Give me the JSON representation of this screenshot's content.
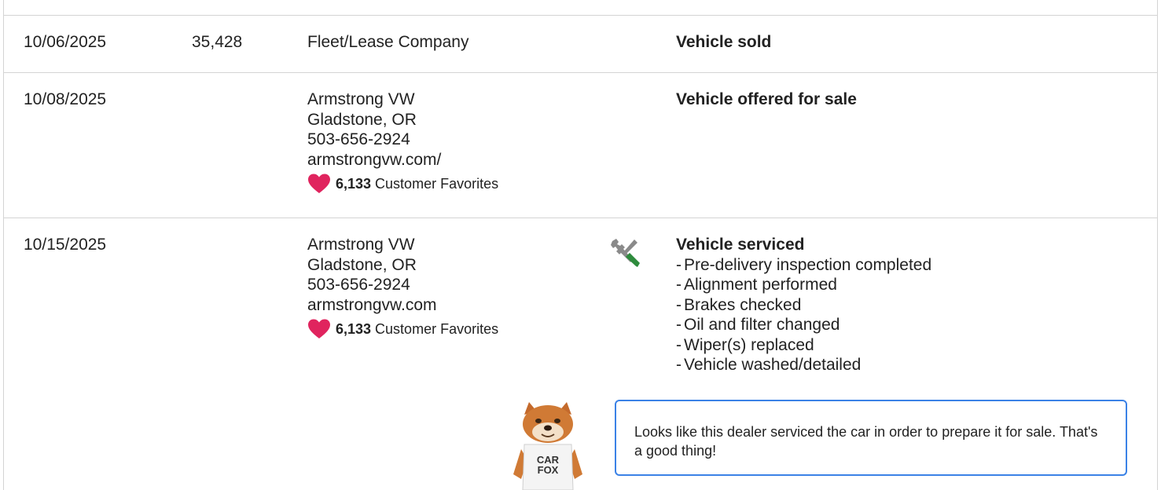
{
  "records": [
    {
      "date": "10/06/2025",
      "odometer": "35,428",
      "source_lines": [
        "Fleet/Lease Company"
      ],
      "title": "Vehicle sold"
    },
    {
      "date": "10/08/2025",
      "odometer": "",
      "source_lines": [
        "Armstrong VW",
        "Gladstone, OR",
        "503-656-2924",
        "armstrongvw.com/"
      ],
      "favorites_count": "6,133",
      "favorites_label": "Customer Favorites",
      "title": "Vehicle offered for sale"
    },
    {
      "date": "10/15/2025",
      "odometer": "",
      "source_lines": [
        "Armstrong VW",
        "Gladstone, OR",
        "503-656-2924",
        "armstrongvw.com"
      ],
      "favorites_count": "6,133",
      "favorites_label": "Customer Favorites",
      "icon": "wrench-screwdriver-icon",
      "title": "Vehicle serviced",
      "details": [
        "Pre-delivery inspection completed",
        "Alignment performed",
        "Brakes checked",
        "Oil and filter changed",
        "Wiper(s) replaced",
        "Vehicle washed/detailed"
      ]
    }
  ],
  "tip": {
    "mascot_shirt": "CAR FOX",
    "text": "Looks like this dealer serviced the car in order to prepare it for sale. That's a good thing!"
  },
  "colors": {
    "heart": "#e0245e",
    "tip_border": "#3b82e6",
    "row_border": "#d4d4d4",
    "wrench_gray": "#8a8a8a",
    "screwdriver_green": "#2e8b3d"
  }
}
